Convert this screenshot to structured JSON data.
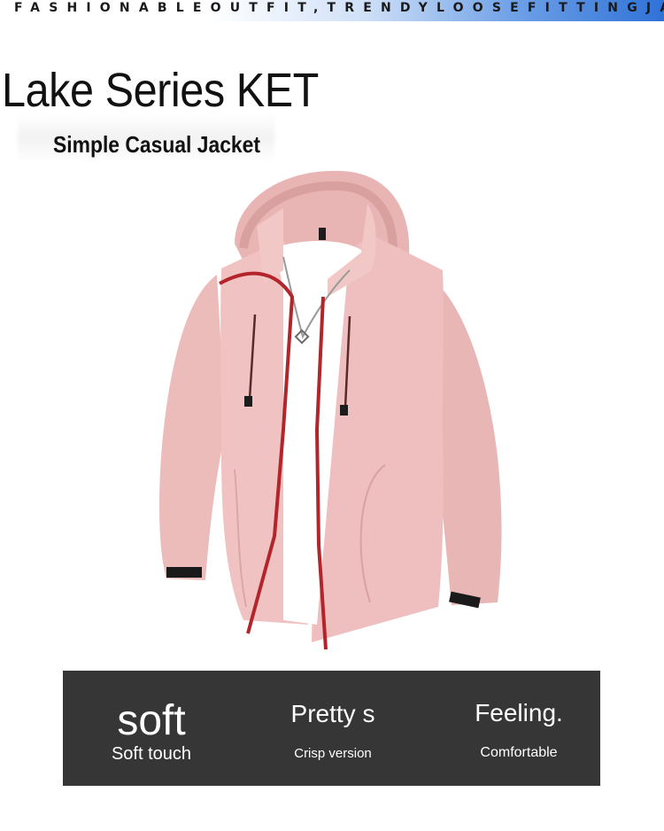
{
  "banner": {
    "text": "FASHIONABLEOUTFIT,TRENDYLOOSEFITTINGJACKET"
  },
  "header": {
    "title": "Lake Series KET",
    "subtitle": "Simple Casual Jacket"
  },
  "product": {
    "icon": "jacket-image",
    "colors": {
      "shell": "#f0c3c2",
      "shell_shadow": "#dea3a3",
      "zipper": "#b3242b",
      "shirt": "#ffffff",
      "cuff_tab": "#1a1a1a"
    }
  },
  "features": [
    {
      "title": "soft",
      "caption": "Soft touch"
    },
    {
      "title": "Pretty s",
      "caption": "Crisp version"
    },
    {
      "title": "Feeling.",
      "caption": "Comfortable"
    }
  ],
  "colors": {
    "panel_bg": "#363636",
    "banner_accent": "#2f72d8",
    "text_dark": "#111111",
    "text_light": "#ffffff"
  }
}
